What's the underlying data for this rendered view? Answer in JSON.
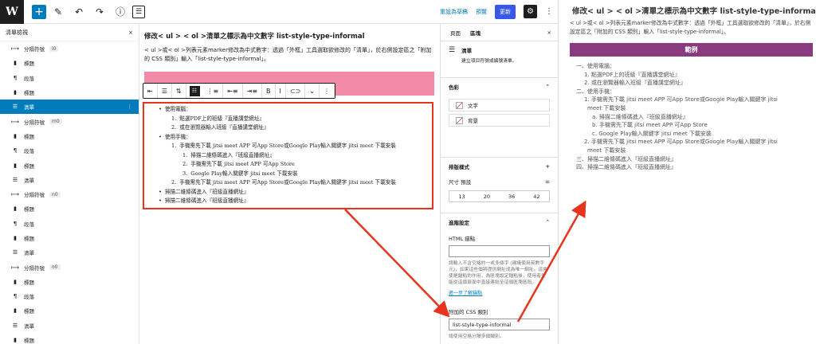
{
  "topbar": {
    "logo": "W",
    "add": "+",
    "draft_link": "重設為草稿",
    "preview_link": "預覽",
    "update_button": "更新",
    "gear": "⚙",
    "more": "⋮"
  },
  "sidebar": {
    "title": "清單檢視",
    "close": "×",
    "items": [
      {
        "icon": "⟼",
        "label": "分隔符號",
        "tag": "l0"
      },
      {
        "icon": "▮",
        "label": "標題",
        "tag": ""
      },
      {
        "icon": "¶",
        "label": "段落",
        "tag": ""
      },
      {
        "icon": "▮",
        "label": "標題",
        "tag": ""
      },
      {
        "icon": "☰",
        "label": "清單",
        "tag": "",
        "active": true
      },
      {
        "icon": "⟼",
        "label": "分隔符號",
        "tag": "m0"
      },
      {
        "icon": "▮",
        "label": "標題",
        "tag": ""
      },
      {
        "icon": "¶",
        "label": "段落",
        "tag": ""
      },
      {
        "icon": "▮",
        "label": "標題",
        "tag": ""
      },
      {
        "icon": "☰",
        "label": "清單",
        "tag": ""
      },
      {
        "icon": "⟼",
        "label": "分隔符號",
        "tag": "n0"
      },
      {
        "icon": "▮",
        "label": "標題",
        "tag": ""
      },
      {
        "icon": "¶",
        "label": "段落",
        "tag": ""
      },
      {
        "icon": "▮",
        "label": "標題",
        "tag": ""
      },
      {
        "icon": "☰",
        "label": "清單",
        "tag": ""
      },
      {
        "icon": "⟼",
        "label": "分隔符號",
        "tag": "o0"
      },
      {
        "icon": "▮",
        "label": "標題",
        "tag": ""
      },
      {
        "icon": "¶",
        "label": "段落",
        "tag": ""
      },
      {
        "icon": "▮",
        "label": "標題",
        "tag": ""
      },
      {
        "icon": "☰",
        "label": "清單",
        "tag": ""
      },
      {
        "icon": "▮",
        "label": "標題",
        "tag": ""
      }
    ]
  },
  "editor": {
    "title": "修改< ul > < ol >清單之標示為中文數字 list-style-type-informal",
    "paragraph": "< ul >或< ol >列表元素marker修改為中式數字：透過「外框」工具選取欲修改的「清單」，於右側設定區之「附加的 CSS 類別」輸入「list-style-type-informal」。",
    "list_lines": [
      {
        "b": "•",
        "t": "使用電腦：",
        "lvl": 0
      },
      {
        "b": "1.",
        "t": "點選PDF上的班級『直播講堂網址』",
        "lvl": 1
      },
      {
        "b": "2.",
        "t": "或在瀏覽器輸入班級『直播講堂網址』",
        "lvl": 1
      },
      {
        "b": "•",
        "t": "使用手機：",
        "lvl": 0
      },
      {
        "b": "1.",
        "t": "手機需先下載 jitsi meet APP 可App Store或Google Play輸入關鍵字 jitsi meet 下載安裝",
        "lvl": 1
      },
      {
        "b": "1.",
        "t": "掃描二維條碼進入『班級直播網址』",
        "lvl": 2
      },
      {
        "b": "2.",
        "t": "手機需先下載 jitsi meet APP 可App Store",
        "lvl": 2
      },
      {
        "b": "3.",
        "t": "Google Play輸入關鍵字 jitsi meet 下載安裝",
        "lvl": 2
      },
      {
        "b": "2.",
        "t": "手機需先下載 jitsi meet APP 可App Store或Google Play輸入關鍵字 jitsi meet 下載安裝",
        "lvl": 1
      },
      {
        "b": "•",
        "t": "掃描二維條碼進入『班級直播網址』",
        "lvl": 0
      },
      {
        "b": "•",
        "t": "掃描二維條碼進入『班級直播網址』",
        "lvl": 0
      }
    ]
  },
  "block_toolbar": [
    "⇤",
    "☰",
    "⇅",
    "☷",
    "⋮≡",
    "⇤≡",
    "⇥≡",
    "B",
    "I",
    "⊂⊃",
    "⌄",
    "⋮"
  ],
  "settings": {
    "tab_page": "頁面",
    "tab_block": "區塊",
    "close": "×",
    "block_name": "清單",
    "block_desc": "建立項目符號或編號清單。",
    "color_title": "色彩",
    "color_text": "文字",
    "color_bg": "背景",
    "typography_title": "排版樣式",
    "size_label": "尺寸 預設",
    "sizes": [
      "13",
      "20",
      "36",
      "42"
    ],
    "advanced_title": "進階設定",
    "anchor_label": "HTML 錨點",
    "anchor_help": "請輸入不含空格的一或多個字 (建議使用英數字元)，如果這些個將提供網址成為唯一網址。這會使是錨點的作用，為區塊設定錨點後，使用者便能從這個頁面中直接連結至這個區塊區段。",
    "anchor_link": "進一步了解錨點",
    "css_label": "附加的 CSS 類別",
    "css_value": "list-style-type-informal",
    "css_help": "請使用空格分隔多個類別。"
  },
  "preview": {
    "title": "修改< ul > < ol >清單之標示為中文數字 list-style-type-informal",
    "desc": "< ul >或< ol >列表元素marker修改為中式數字：透過「外框」工具選取欲修改的「清單」，於右側設定區之「附加的 CSS 類別」輸入「list-style-type-informal」。",
    "banner": "範例",
    "lines": [
      {
        "t": "一、使用電腦：",
        "lvl": 0
      },
      {
        "t": "1. 點選PDF上的班級『直播講堂網址』",
        "lvl": 1
      },
      {
        "t": "2. 或在瀏覽器輸入班級『直播講堂網址』",
        "lvl": 1
      },
      {
        "t": "二、使用手機：",
        "lvl": 0
      },
      {
        "t": "1. 手機需先下載 jitsi meet APP 可App Store或Google Play輸入關鍵字 jitsi",
        "lvl": 1
      },
      {
        "t": "meet 下載安裝",
        "lvl": 1.4
      },
      {
        "t": "a. 掃描二維條碼進入『班級直播網址』",
        "lvl": 2
      },
      {
        "t": "b. 手機需先下載 jitsi meet APP 可App Store",
        "lvl": 2
      },
      {
        "t": "c. Google Play輸入關鍵字 jitsi meet 下載安裝",
        "lvl": 2
      },
      {
        "t": "2. 手機需先下載 jitsi meet APP 可App Store或Google Play輸入關鍵字 jitsi",
        "lvl": 1
      },
      {
        "t": "meet 下載安裝",
        "lvl": 1.4
      },
      {
        "t": "三、掃描二維條碼進入『班級直播網址』",
        "lvl": 0
      },
      {
        "t": "四、掃描二維條碼進入『班級直播網址』",
        "lvl": 0
      }
    ]
  },
  "colors": {
    "accent": "#007cba",
    "update": "#3858e9",
    "highlight_box": "#e8341c",
    "banner": "#8a3a7e",
    "pink": "#f18ba7"
  }
}
